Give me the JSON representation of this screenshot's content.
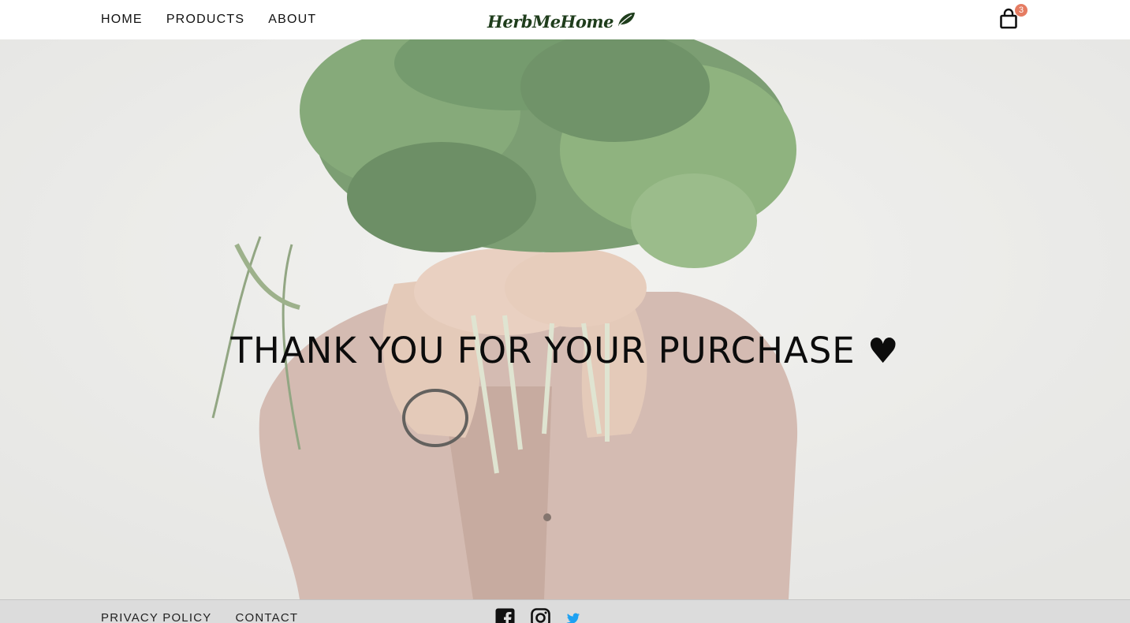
{
  "header": {
    "nav": [
      {
        "label": "HOME"
      },
      {
        "label": "PRODUCTS"
      },
      {
        "label": "ABOUT"
      }
    ],
    "logo_text": "HerbMeHome",
    "cart": {
      "count": "3",
      "icon": "shopping-bag-icon"
    }
  },
  "hero": {
    "title": "THANK YOU FOR YOUR PURCHASE",
    "heart": "♥"
  },
  "footer": {
    "links": [
      {
        "label": "PRIVACY POLICY"
      },
      {
        "label": "CONTACT"
      }
    ],
    "social": [
      "facebook-icon",
      "instagram-icon",
      "twitter-icon"
    ]
  },
  "colors": {
    "badge": "#e57c62",
    "logo": "#1f3d1c",
    "footer_bg": "#dcdcdc",
    "twitter": "#1da1f2"
  }
}
